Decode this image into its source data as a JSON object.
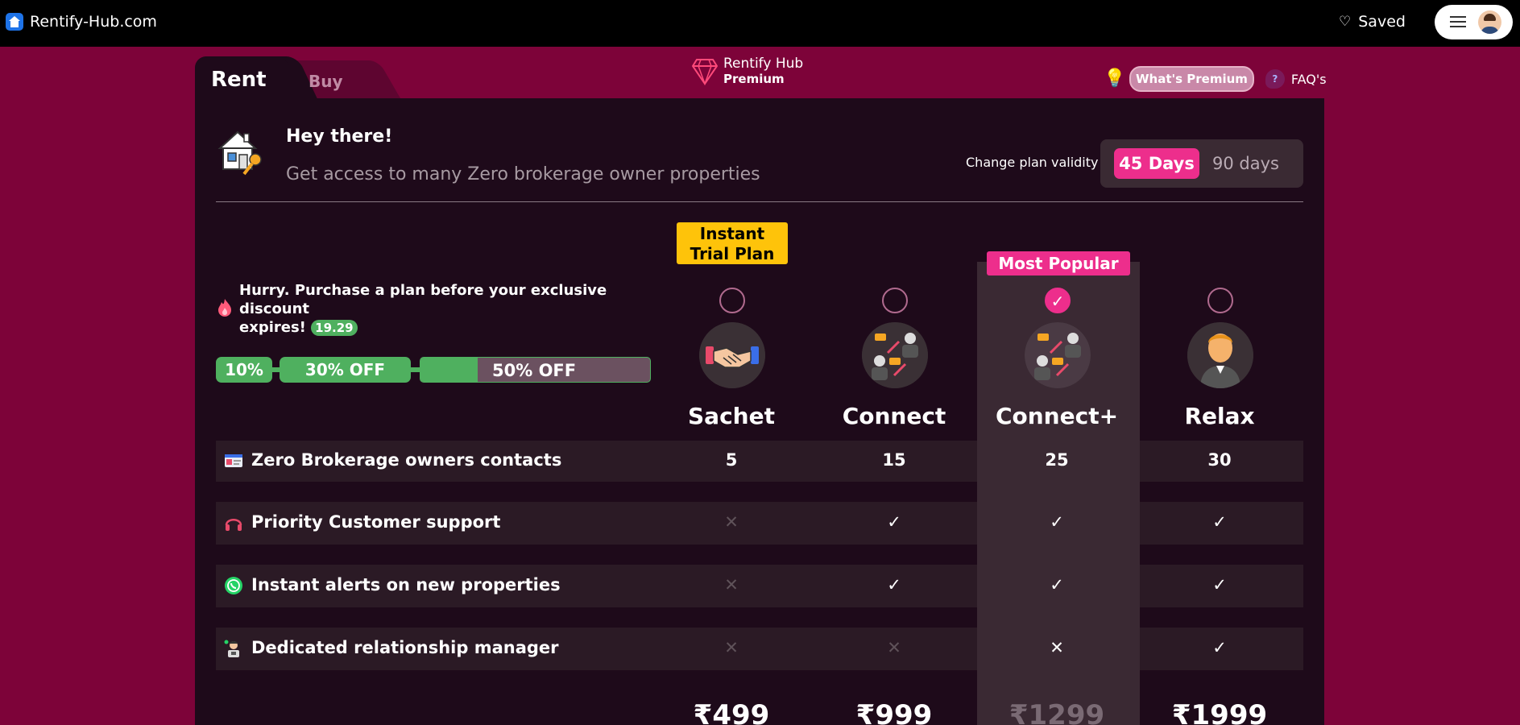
{
  "site": {
    "name": "Rentify-Hub.com",
    "saved_label": "Saved"
  },
  "tabs": [
    {
      "label": "Rent",
      "active": true
    },
    {
      "label": "Buy",
      "active": false
    }
  ],
  "brand": {
    "line1": "Rentify Hub",
    "line2": "Premium"
  },
  "help": {
    "whats_premium": "What's Premium",
    "faqs": "FAQ's",
    "faq_badge": "?"
  },
  "greeting": {
    "title": "Hey there!",
    "subtitle": "Get access to many Zero brokerage owner properties"
  },
  "validity": {
    "label": "Change plan validity",
    "options": [
      "45 Days",
      "90 days"
    ],
    "selected": "45 Days"
  },
  "promo": {
    "text_line1": "Hurry. Purchase a plan before your exclusive discount",
    "text_line2": "expires!",
    "timer": "19.29",
    "discounts": [
      "10%",
      "30% OFF",
      "50% OFF"
    ],
    "progress_fraction_of_last": 0.25
  },
  "badges": {
    "trial_line1": "Instant",
    "trial_line2": "Trial Plan",
    "popular": "Most Popular"
  },
  "plans": [
    {
      "name": "Sachet",
      "selected": false,
      "price": "₹499",
      "icon": "handshake-icon"
    },
    {
      "name": "Connect",
      "selected": false,
      "price": "₹999",
      "icon": "people-connect-icon"
    },
    {
      "name": "Connect+",
      "selected": true,
      "price": "₹1299",
      "icon": "people-connect-icon"
    },
    {
      "name": "Relax",
      "selected": false,
      "price": "₹1999",
      "icon": "businessman-icon"
    }
  ],
  "features": [
    {
      "label": "Zero Brokerage owners contacts",
      "icon": "contact-card-icon",
      "values": [
        "5",
        "15",
        "25",
        "30"
      ]
    },
    {
      "label": "Priority Customer support",
      "icon": "headphones-icon",
      "values": [
        "✕",
        "✓",
        "✓",
        "✓"
      ]
    },
    {
      "label": "Instant alerts on new properties",
      "icon": "whatsapp-icon",
      "values": [
        "✕",
        "✓",
        "✓",
        "✓"
      ]
    },
    {
      "label": "Dedicated relationship manager",
      "icon": "manager-icon",
      "values": [
        "✕",
        "✕",
        "✕",
        "✓"
      ]
    }
  ],
  "colors": {
    "background": "#7d0339",
    "panel": "#1e0a1a",
    "accent": "#ed2e8c",
    "green": "#4fb05f",
    "trial": "#fec30a"
  }
}
